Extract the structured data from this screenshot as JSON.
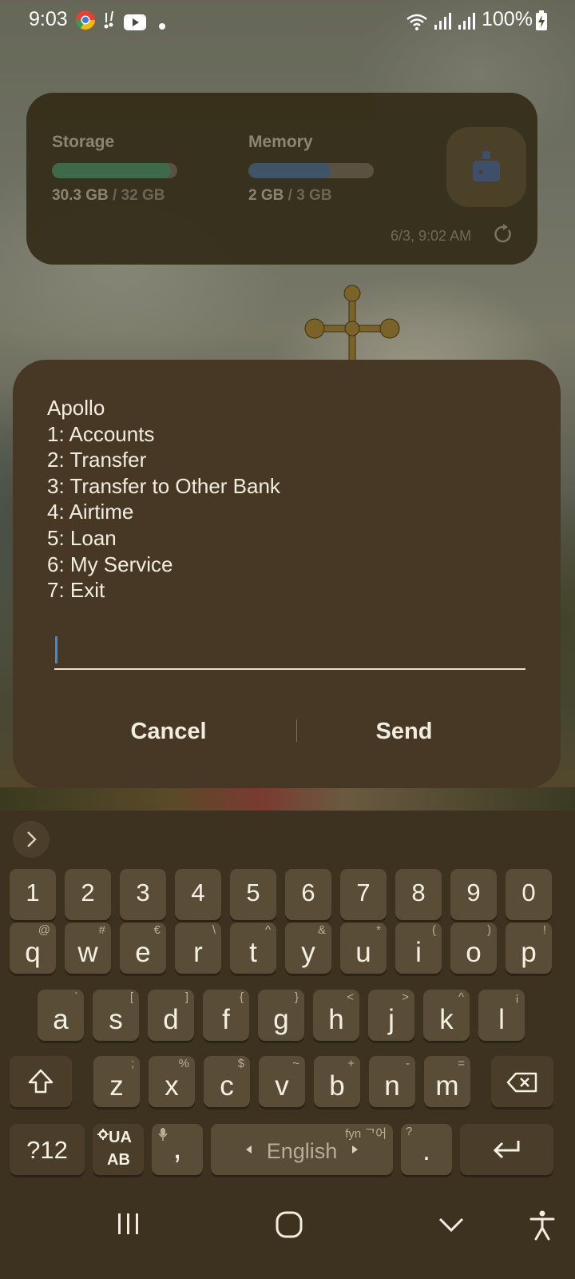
{
  "status_bar": {
    "time": "9:03",
    "battery": "100%",
    "icons": [
      "chrome-icon",
      "notification-icon",
      "youtube-icon",
      "dot-icon",
      "wifi-icon",
      "signal-icon",
      "signal-icon",
      "battery-charging-icon"
    ]
  },
  "widget": {
    "storage_label": "Storage",
    "storage_used": "30.3 GB",
    "storage_total": "/ 32 GB",
    "storage_fraction": 0.95,
    "memory_label": "Memory",
    "memory_used": "2 GB",
    "memory_total": "/ 3 GB",
    "memory_fraction": 0.66,
    "updated": "6/3, 9:02 AM",
    "clean_icon": "broom-icon",
    "refresh_icon": "refresh-icon",
    "colors": {
      "storage_fill": "#3e6a4c",
      "memory_fill": "#3f5466"
    }
  },
  "dialog": {
    "message": "Apollo\n1: Accounts\n2: Transfer\n3: Transfer to Other Bank\n4: Airtime\n5: Loan\n6: My Service\n7: Exit",
    "input_value": "",
    "cancel_label": "Cancel",
    "send_label": "Send"
  },
  "keyboard": {
    "number_row": [
      "1",
      "2",
      "3",
      "4",
      "5",
      "6",
      "7",
      "8",
      "9",
      "0"
    ],
    "row1": [
      {
        "key": "q",
        "alt": "@"
      },
      {
        "key": "w",
        "alt": "#"
      },
      {
        "key": "e",
        "alt": "€"
      },
      {
        "key": "r",
        "alt": "\\"
      },
      {
        "key": "t",
        "alt": "^"
      },
      {
        "key": "y",
        "alt": "&"
      },
      {
        "key": "u",
        "alt": "*"
      },
      {
        "key": "i",
        "alt": "("
      },
      {
        "key": "o",
        "alt": ")"
      },
      {
        "key": "p",
        "alt": "!"
      }
    ],
    "row2": [
      {
        "key": "a",
        "alt": "`"
      },
      {
        "key": "s",
        "alt": "["
      },
      {
        "key": "d",
        "alt": "]"
      },
      {
        "key": "f",
        "alt": "{"
      },
      {
        "key": "g",
        "alt": "}"
      },
      {
        "key": "h",
        "alt": "<"
      },
      {
        "key": "j",
        "alt": ">"
      },
      {
        "key": "k",
        "alt": "^"
      },
      {
        "key": "l",
        "alt": "¡"
      }
    ],
    "row3": [
      {
        "key": "z",
        "alt": ";"
      },
      {
        "key": "x",
        "alt": "%"
      },
      {
        "key": "c",
        "alt": "$"
      },
      {
        "key": "v",
        "alt": "~"
      },
      {
        "key": "b",
        "alt": "+"
      },
      {
        "key": "n",
        "alt": "-"
      },
      {
        "key": "m",
        "alt": "="
      }
    ],
    "symbols_label": "?12",
    "layout_top": "UA",
    "layout_bottom": "AB",
    "comma": ",",
    "space_label": "English",
    "space_hint": "fyn ᄀ어",
    "period": ".",
    "period_alt": "?",
    "toolbar_icon": "chevron-right-icon"
  },
  "nav_bar": {
    "icons": [
      "recents-icon",
      "home-icon",
      "hide-keyboard-icon",
      "accessibility-icon"
    ]
  }
}
